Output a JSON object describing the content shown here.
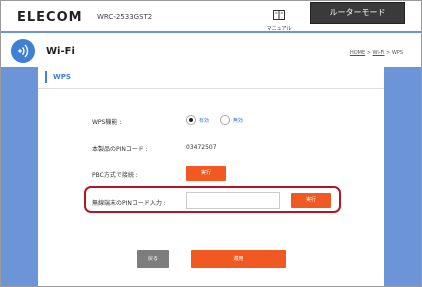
{
  "header": {
    "brand": "ELECOM",
    "model": "WRC-2533GST2",
    "manual_label": "マニュアル",
    "mode_tab": "ルーターモード"
  },
  "page": {
    "title": "Wi-Fi",
    "breadcrumb": [
      "HOME",
      ">",
      "Wi-Fi",
      ">",
      "WPS"
    ],
    "section": "WPS"
  },
  "form": {
    "wps_label": "WPS機能 :",
    "wps_on": "有効",
    "wps_off": "無効",
    "wps_selected": "有効",
    "pin_label": "本製品のPINコード :",
    "pin_value": "03472507",
    "pbc_label": "PBC方式で接続 :",
    "pbc_button": "実行",
    "client_pin_label": "無線端末のPINコード入力 :",
    "client_pin_value": "",
    "client_pin_button": "実行"
  },
  "actions": {
    "back": "戻る",
    "apply": "適用"
  },
  "colors": {
    "accent_blue": "#3f7fd6",
    "button_orange": "#f05a22",
    "highlight_red": "#b1162d",
    "background_blue": "#6b95d6"
  }
}
